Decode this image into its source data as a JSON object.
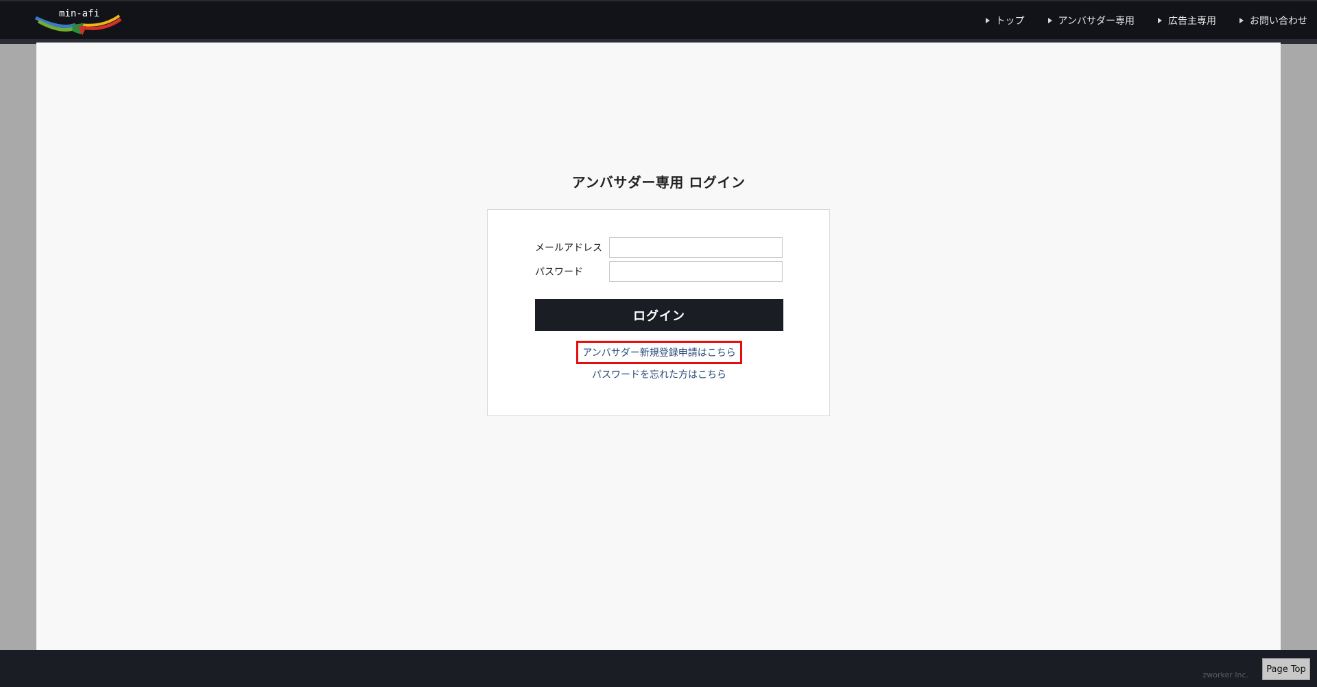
{
  "header": {
    "logo_text": "min-afi",
    "nav": [
      {
        "label": "トップ"
      },
      {
        "label": "アンバサダー専用"
      },
      {
        "label": "広告主専用"
      },
      {
        "label": "お問い合わせ"
      }
    ]
  },
  "login": {
    "title": "アンバサダー専用 ログイン",
    "email_label": "メールアドレス",
    "email_value": "",
    "password_label": "パスワード",
    "password_value": "",
    "button_label": "ログイン",
    "register_link": "アンバサダー新規登録申請はこちら",
    "forgot_link": "パスワードを忘れた方はこちら"
  },
  "footer": {
    "copyright": "zworker Inc.",
    "page_top": "Page Top"
  },
  "colors": {
    "header_bg": "#111318",
    "button_bg": "#1b1d25",
    "link": "#274a78",
    "highlight": "#e60d0d"
  }
}
